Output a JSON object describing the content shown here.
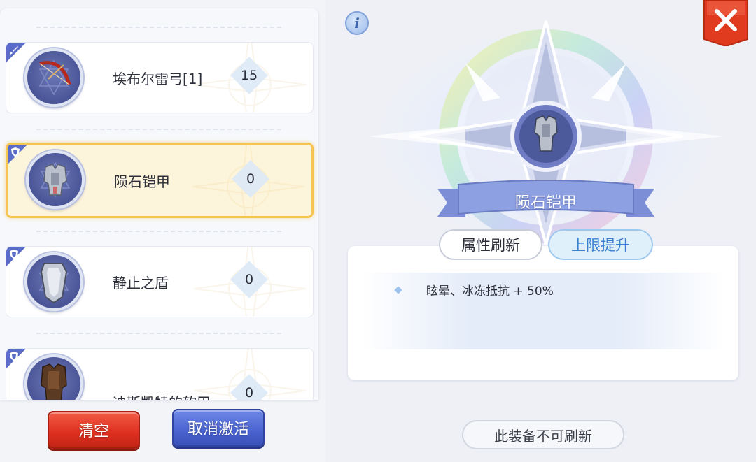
{
  "equipment_list": [
    {
      "name": "埃布尔雷弓[1]",
      "count": "15",
      "category_icon": "sword-icon",
      "item_icon": "bow-icon",
      "selected": false
    },
    {
      "name": "陨石铠甲",
      "count": "0",
      "category_icon": "shield-emblem-icon",
      "item_icon": "armor-icon",
      "selected": true
    },
    {
      "name": "静止之盾",
      "count": "0",
      "category_icon": "shield-emblem-icon",
      "item_icon": "shield-icon",
      "selected": false
    },
    {
      "name": "迪斯凯特的软甲",
      "count": "0",
      "category_icon": "shield-emblem-icon",
      "item_icon": "leather-armor-icon",
      "selected": false
    }
  ],
  "buttons": {
    "clear": "清空",
    "deactivate": "取消激活"
  },
  "detail": {
    "info_icon": "info-icon",
    "close_icon": "close-icon",
    "selected_item_name": "陨石铠甲",
    "tabs": [
      {
        "label": "属性刷新",
        "active": false
      },
      {
        "label": "上限提升",
        "active": true
      }
    ],
    "attribute": "眩晕、冰冻抵抗 + 50%",
    "status": "此装备不可刷新"
  },
  "colors": {
    "selected_border": "#f5c451",
    "clear_button": "#dd2f1f",
    "deactivate_button": "#4a63cf",
    "category_corner": "#5a6cc8",
    "close_button": "#e03a1f"
  }
}
